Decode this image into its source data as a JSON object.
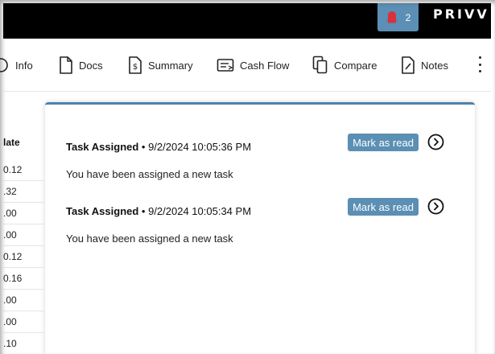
{
  "header": {
    "notification_count": "2",
    "brand": "PRIVV",
    "bell_color": "#d6313f",
    "accent": "#5c8fb5"
  },
  "toolbar": {
    "items": [
      {
        "label": "Info",
        "icon": "info-icon"
      },
      {
        "label": "Docs",
        "icon": "document-icon"
      },
      {
        "label": "Summary",
        "icon": "dollar-document-icon"
      },
      {
        "label": "Cash Flow",
        "icon": "cash-flow-icon"
      },
      {
        "label": "Compare",
        "icon": "copy-icon"
      },
      {
        "label": "Notes",
        "icon": "edit-note-icon"
      }
    ],
    "more": "kebab-menu-icon"
  },
  "table": {
    "column_header": "late",
    "values": [
      "0.12",
      ".32",
      ".00",
      ".00",
      "0.12",
      "0.16",
      ".00",
      ".00",
      ".10"
    ]
  },
  "notifications": {
    "items": [
      {
        "title": "Task Assigned",
        "separator": " • ",
        "timestamp": "9/2/2024 10:05:36 PM",
        "message": "You have been assigned a new task",
        "action": "Mark as read"
      },
      {
        "title": "Task Assigned",
        "separator": " • ",
        "timestamp": "9/2/2024 10:05:34 PM",
        "message": "You have been assigned a new task",
        "action": "Mark as read"
      }
    ]
  }
}
